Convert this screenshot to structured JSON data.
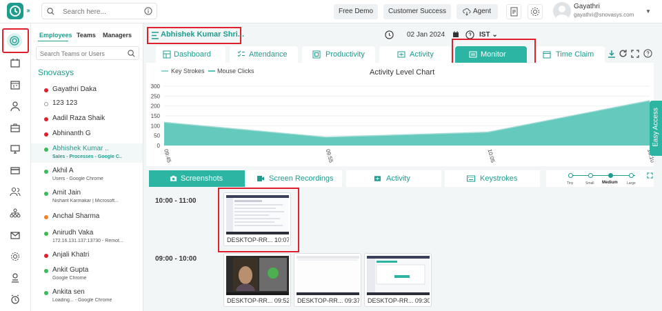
{
  "topbar": {
    "search_placeholder": "Search here...",
    "free_demo": "Free Demo",
    "customer_success": "Customer Success",
    "agent": "Agent",
    "user_name": "Gayathri",
    "user_email": "gayathri@snovasys.com"
  },
  "panel": {
    "tabs": [
      "Employees",
      "Teams",
      "Managers"
    ],
    "search_placeholder": "Search Teams or Users",
    "org": "Snovasys",
    "employees": [
      {
        "name": "Gayathri Daka",
        "sub": "",
        "status": "#e01f2c"
      },
      {
        "name": "123 123",
        "sub": "",
        "status": "#ffffff"
      },
      {
        "name": "Aadil Raza Shaik",
        "sub": "",
        "status": "#e01f2c"
      },
      {
        "name": "Abhinanth G",
        "sub": "",
        "status": "#e01f2c"
      },
      {
        "name": "Abhishek Kumar ..",
        "sub": "Sales - Processes - Google C..",
        "status": "#3cba54"
      },
      {
        "name": "Akhil A",
        "sub": "Users - Google Chrome",
        "status": "#3cba54"
      },
      {
        "name": "Amit Jain",
        "sub": "Nishant Karmakar | Microsoft...",
        "status": "#3cba54"
      },
      {
        "name": "Anchal Sharma",
        "sub": "",
        "status": "#f58220"
      },
      {
        "name": "Anirudh Vaka",
        "sub": "172.16.131.137:13730 - Remot...",
        "status": "#3cba54"
      },
      {
        "name": "Anjali Khatri",
        "sub": "",
        "status": "#e01f2c"
      },
      {
        "name": "Ankit Gupta",
        "sub": "Google Chrome",
        "status": "#3cba54"
      },
      {
        "name": "Ankita sen",
        "sub": "Loading... - Google Chrome",
        "status": "#3cba54"
      }
    ]
  },
  "main": {
    "selected_employee": "Abhishek Kumar Shri...",
    "date": "02 Jan 2024",
    "timezone": "IST",
    "tabs": [
      "Dashboard",
      "Attendance",
      "Productivity",
      "Activity",
      "Monitor",
      "Time Claim"
    ],
    "active_tab": "Monitor",
    "subtabs": [
      "Screenshots",
      "Screen Recordings",
      "Activity",
      "Keystrokes"
    ],
    "zoom_levels": [
      "Tiny",
      "Small",
      "Medium",
      "Large"
    ],
    "zoom_selected": "Medium",
    "easy_access": "Easy Access",
    "screenshot_groups": [
      {
        "time": "10:00 - 11:00",
        "shots": [
          {
            "caption": "DESKTOP-RR... 10:07 I"
          }
        ]
      },
      {
        "time": "09:00 - 10:00",
        "shots": [
          {
            "caption": "DESKTOP-RR... 09:52"
          },
          {
            "caption": "DESKTOP-RR... 09:37"
          },
          {
            "caption": "DESKTOP-RR... 09:30"
          }
        ]
      }
    ]
  },
  "chart_data": {
    "type": "area",
    "title": "Activity Level Chart",
    "series": [
      {
        "name": "Key Strokes",
        "color": "#8fd5cc",
        "values": [
          120,
          45,
          70,
          230
        ]
      },
      {
        "name": "Mouse Clicks",
        "color": "#4fc3b4",
        "values": [
          115,
          40,
          65,
          225
        ]
      }
    ],
    "x": [
      "09:45",
      "09:55",
      "10:05",
      "10:10"
    ],
    "yticks": [
      "300",
      "250",
      "200",
      "150",
      "100",
      "50",
      "0"
    ],
    "ylim": [
      0,
      300
    ],
    "legend": "top-left"
  }
}
